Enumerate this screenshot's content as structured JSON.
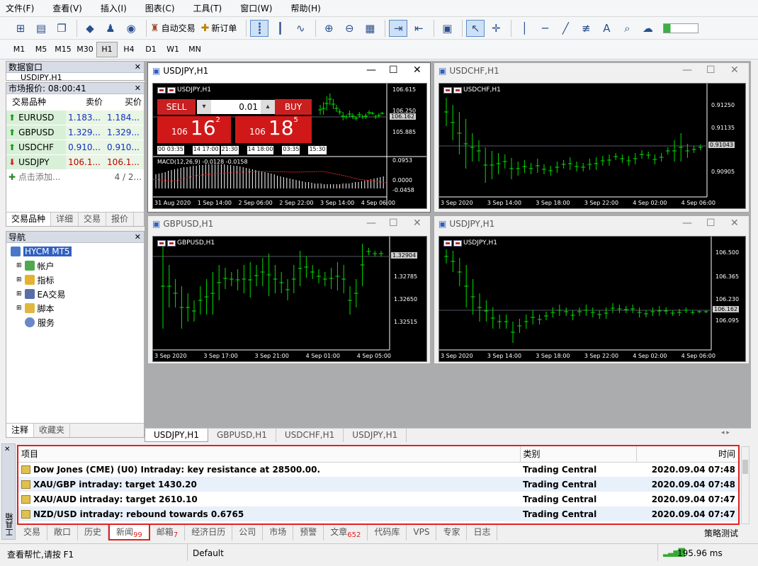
{
  "menu": [
    "文件(F)",
    "查看(V)",
    "插入(I)",
    "图表(C)",
    "工具(T)",
    "窗口(W)",
    "帮助(H)"
  ],
  "toolbar": {
    "auto_trade": "自动交易",
    "new_order": "新订单"
  },
  "timeframes": [
    "M1",
    "M5",
    "M15",
    "M30",
    "H1",
    "H4",
    "D1",
    "W1",
    "MN"
  ],
  "data_window": {
    "title": "数据窗口",
    "item": "USDJPY,H1"
  },
  "market_watch": {
    "title": "市场报价: 08:00:41",
    "cols": [
      "交易品种",
      "卖价",
      "买价"
    ],
    "rows": [
      {
        "sym": "EURUSD",
        "bid": "1.183...",
        "ask": "1.184...",
        "dir": "up"
      },
      {
        "sym": "GBPUSD",
        "bid": "1.329...",
        "ask": "1.329...",
        "dir": "up"
      },
      {
        "sym": "USDCHF",
        "bid": "0.910...",
        "ask": "0.910...",
        "dir": "up"
      },
      {
        "sym": "USDJPY",
        "bid": "106.1...",
        "ask": "106.1...",
        "dir": "down"
      }
    ],
    "add": "点击添加...",
    "count": "4 / 2...",
    "tabs": [
      "交易品种",
      "详细",
      "交易",
      "报价"
    ]
  },
  "navigator": {
    "title": "导航",
    "items": [
      "HYCM MT5",
      "帐户",
      "指标",
      "EA交易",
      "脚本",
      "服务"
    ],
    "tabs": [
      "注释",
      "收藏夹"
    ]
  },
  "charts": {
    "usdjpy_main": {
      "title": "USDJPY,H1",
      "sell": "SELL",
      "buy": "BUY",
      "lot": "0.01",
      "sell_small": "106",
      "sell_big": "16",
      "sell_sup": "2",
      "buy_small": "106",
      "buy_big": "18",
      "buy_sup": "5",
      "prices": [
        "106.615",
        "106.250",
        "106.162",
        "105.885"
      ],
      "macd": "MACD(12,26,9) -0.0128 -0.0158",
      "macd_ax": [
        "0.0953",
        "0.0000",
        "-0.0458"
      ],
      "times": [
        "31 Aug 2020",
        "1 Sep 14:00",
        "2 Sep 06:00",
        "2 Sep 22:00",
        "3 Sep 14:00",
        "4 Sep 06:00"
      ],
      "minis": [
        "00 03:35",
        "14 17:00",
        "21:30",
        "14 18:00",
        "03:35",
        "15:30"
      ]
    },
    "usdchf": {
      "title": "USDCHF,H1",
      "prices": [
        "0.91250",
        "0.91135",
        "0.91043",
        "0.90905"
      ],
      "times": [
        "3 Sep 2020",
        "3 Sep 14:00",
        "3 Sep 18:00",
        "3 Sep 22:00",
        "4 Sep 02:00",
        "4 Sep 06:00"
      ]
    },
    "gbpusd": {
      "title": "GBPUSD,H1",
      "prices": [
        "1.32904",
        "1.32785",
        "1.32650",
        "1.32515"
      ],
      "times": [
        "3 Sep 2020",
        "3 Sep 17:00",
        "3 Sep 21:00",
        "4 Sep 01:00",
        "4 Sep 05:00"
      ]
    },
    "usdjpy": {
      "title": "USDJPY,H1",
      "prices": [
        "106.500",
        "106.365",
        "106.230",
        "106.162",
        "106.095"
      ],
      "times": [
        "3 Sep 2020",
        "3 Sep 14:00",
        "3 Sep 18:00",
        "3 Sep 22:00",
        "4 Sep 02:00",
        "4 Sep 06:00"
      ]
    }
  },
  "chart_tabs": [
    "USDJPY,H1",
    "GBPUSD,H1",
    "USDCHF,H1",
    "USDJPY,H1"
  ],
  "news": {
    "cols": [
      "项目",
      "类别",
      "时间"
    ],
    "rows": [
      {
        "title": "Dow Jones (CME) (U0) Intraday: key resistance at 28500.00.",
        "cat": "Trading Central",
        "time": "2020.09.04 07:48"
      },
      {
        "title": "XAU/GBP intraday: target 1430.20",
        "cat": "Trading Central",
        "time": "2020.09.04 07:48"
      },
      {
        "title": "XAU/AUD intraday: target 2610.10",
        "cat": "Trading Central",
        "time": "2020.09.04 07:47"
      },
      {
        "title": "NZD/USD intraday: rebound towards 0.6765",
        "cat": "Trading Central",
        "time": "2020.09.04 07:47"
      }
    ]
  },
  "toolbox_label": "工具箱",
  "bottom_tabs": [
    {
      "l": "交易"
    },
    {
      "l": "敞口"
    },
    {
      "l": "历史"
    },
    {
      "l": "新闻",
      "n": "99"
    },
    {
      "l": "邮箱",
      "n": "7"
    },
    {
      "l": "经济日历"
    },
    {
      "l": "公司"
    },
    {
      "l": "市场"
    },
    {
      "l": "预警"
    },
    {
      "l": "文章",
      "n": "652"
    },
    {
      "l": "代码库"
    },
    {
      "l": "VPS"
    },
    {
      "l": "专家"
    },
    {
      "l": "日志"
    }
  ],
  "strategy": "策略测试",
  "status": {
    "help": "查看帮忙,请按 F1",
    "profile": "Default",
    "ping": "195.96 ms"
  }
}
